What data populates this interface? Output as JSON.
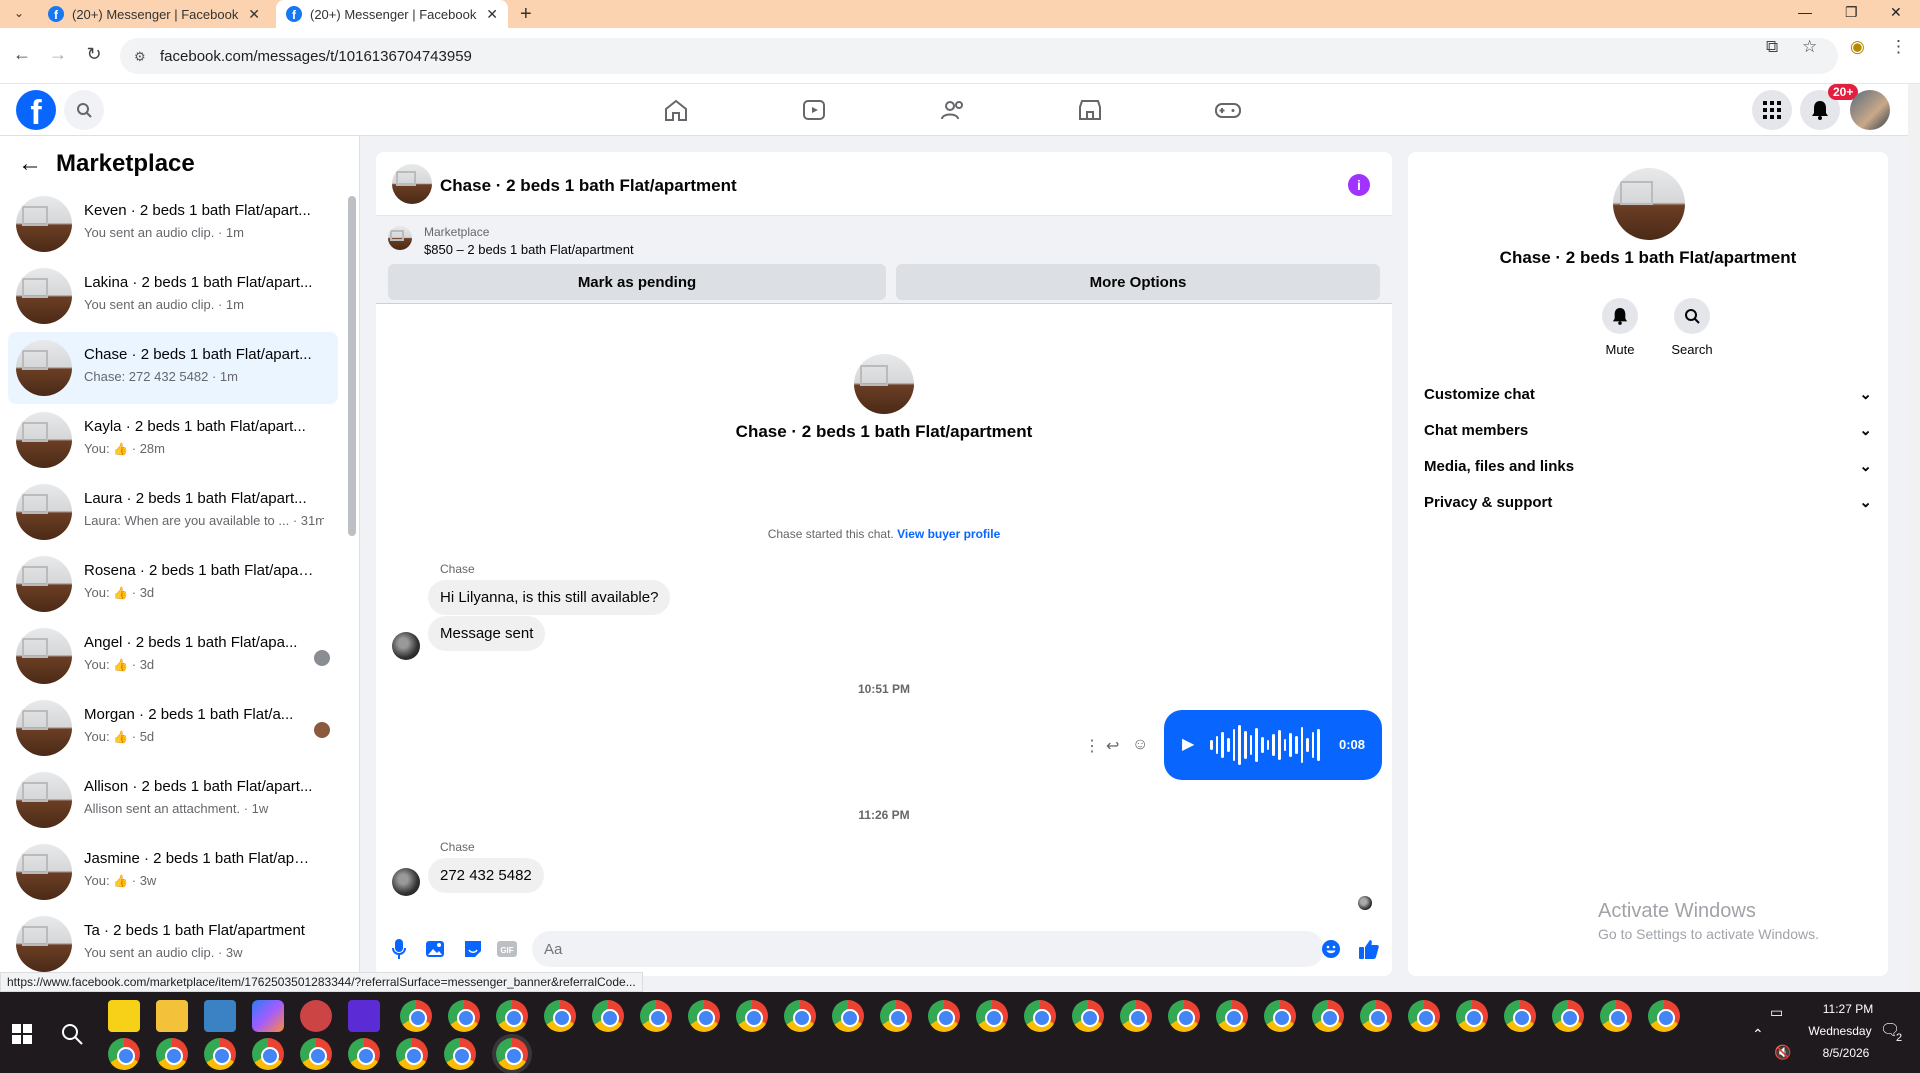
{
  "browser": {
    "tabs": [
      {
        "title": "(20+) Messenger | Facebook"
      },
      {
        "title": "(20+) Messenger | Facebook"
      }
    ],
    "url": "facebook.com/messages/t/1016136704743959",
    "status_url": "https://www.facebook.com/marketplace/item/1762503501283344/?referralSurface=messenger_banner&referralCode..."
  },
  "header": {
    "notification_badge": "20+"
  },
  "sidebar": {
    "title": "Marketplace",
    "conversations": [
      {
        "name": "Keven · 2 beds 1 bath Flat/apart...",
        "preview": "You sent an audio clip.",
        "time": "· 1m",
        "like": false,
        "active": false
      },
      {
        "name": "Lakina · 2 beds 1 bath Flat/apart...",
        "preview": "You sent an audio clip.",
        "time": "· 1m",
        "like": false,
        "active": false
      },
      {
        "name": "Chase · 2 beds 1 bath Flat/apart...",
        "preview": "Chase: 272 432 5482",
        "time": "· 1m",
        "like": false,
        "active": true
      },
      {
        "name": "Kayla · 2 beds 1 bath Flat/apart...",
        "preview": "You:",
        "time": "· 28m",
        "like": true,
        "active": false
      },
      {
        "name": "Laura · 2 beds 1 bath Flat/apart...",
        "preview": "Laura: When are you available to ...",
        "time": "· 31m",
        "like": false,
        "active": false
      },
      {
        "name": "Rosena · 2 beds 1 bath Flat/apar...",
        "preview": "You:",
        "time": "· 3d",
        "like": true,
        "active": false
      },
      {
        "name": "Angel · 2 beds 1 bath Flat/apa...",
        "preview": "You:",
        "time": "· 3d",
        "like": true,
        "active": false,
        "seen": true
      },
      {
        "name": "Morgan · 2 beds 1 bath Flat/a...",
        "preview": "You:",
        "time": "· 5d",
        "like": true,
        "active": false,
        "seen": true
      },
      {
        "name": "Allison · 2 beds 1 bath Flat/apart...",
        "preview": "Allison sent an attachment.",
        "time": "· 1w",
        "like": false,
        "active": false
      },
      {
        "name": "Jasmine · 2 beds 1 bath Flat/apa...",
        "preview": "You:",
        "time": "· 3w",
        "like": true,
        "active": false
      },
      {
        "name": "Ta · 2 beds 1 bath Flat/apartment",
        "preview": "You sent an audio clip.",
        "time": "· 3w",
        "like": false,
        "active": false
      }
    ]
  },
  "chat": {
    "title": "Chase · 2 beds 1 bath Flat/apartment",
    "banner": {
      "label": "Marketplace",
      "listing": "$850 – 2 beds 1 bath Flat/apartment",
      "btn_pending": "Mark as pending",
      "btn_more": "More Options"
    },
    "intro_name": "Chase · 2 beds 1 bath Flat/apartment",
    "started_text": "Chase started this chat.",
    "view_profile": "View buyer profile",
    "sender1": "Chase",
    "msg1": "Hi Lilyanna, is this still available?",
    "msg2": "Message sent",
    "time1": "10:51 PM",
    "audio_duration": "0:08",
    "time2": "11:26 PM",
    "sender2": "Chase",
    "msg3": "272 432 5482",
    "composer_placeholder": "Aa"
  },
  "right_panel": {
    "name": "Chase · 2 beds 1 bath Flat/apartment",
    "actions": [
      {
        "label": "Mute"
      },
      {
        "label": "Search"
      }
    ],
    "sections": [
      {
        "label": "Customize chat"
      },
      {
        "label": "Chat members"
      },
      {
        "label": "Media, files and links"
      },
      {
        "label": "Privacy & support"
      }
    ],
    "watermark_title": "Activate Windows",
    "watermark_sub": "Go to Settings to activate Windows."
  },
  "taskbar": {
    "time": "11:27 PM",
    "day": "Wednesday",
    "date": "8/5/2026",
    "notif_count": "2"
  },
  "colors": {
    "accent": "#0866ff",
    "active_conv": "#ebf5ff",
    "info": "#a033ff",
    "badge": "#e41e3f",
    "tabbar": "#fbd3b0"
  }
}
